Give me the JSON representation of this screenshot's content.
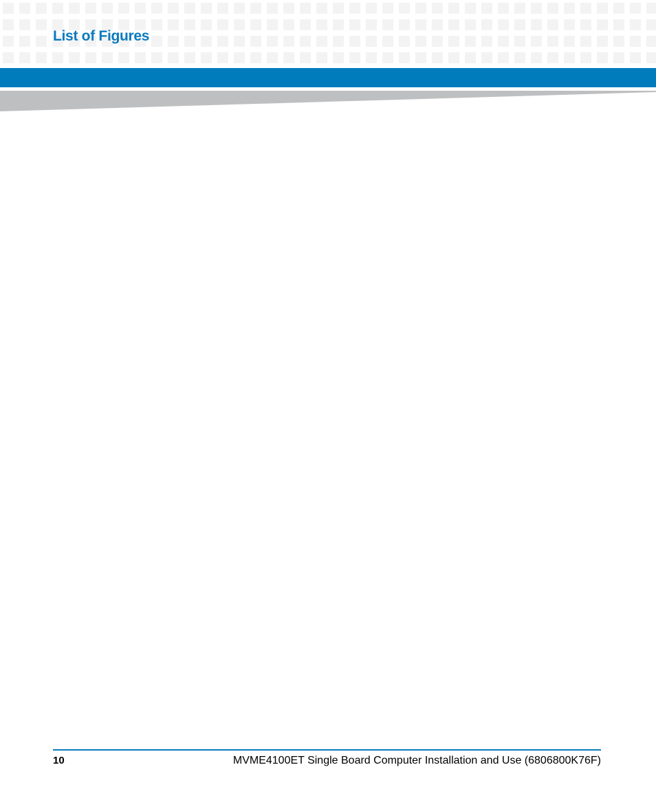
{
  "header": {
    "chapter_title": "List of Figures",
    "colors": {
      "accent_blue": "#007cbd",
      "title_blue": "#0a7bbf",
      "wedge_gray": "#bebfc1",
      "grid_square": "#f3f3f3"
    }
  },
  "footer": {
    "page_number": "10",
    "document_title": "MVME4100ET Single Board Computer Installation and Use (6806800K76F)"
  }
}
